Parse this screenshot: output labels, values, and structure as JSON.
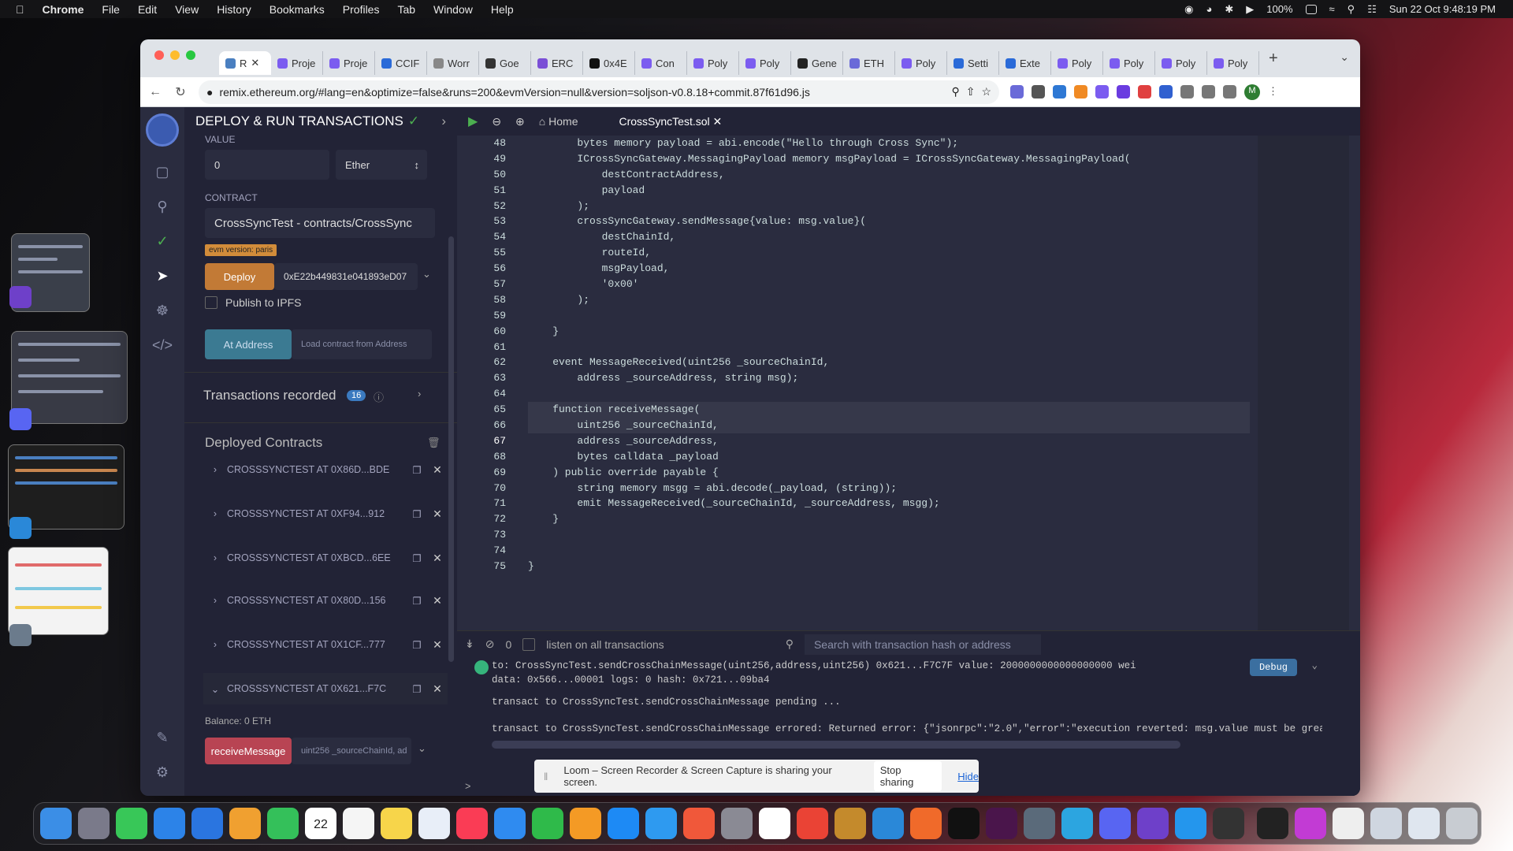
{
  "menubar": {
    "app": "Chrome",
    "items": [
      "File",
      "Edit",
      "View",
      "History",
      "Bookmarks",
      "Profiles",
      "Tab",
      "Window",
      "Help"
    ],
    "battery": "100%",
    "datetime": "Sun 22 Oct  9:48:19 PM"
  },
  "browser": {
    "tabs": [
      "R",
      "Proje",
      "Proje",
      "CCIF",
      "Worr",
      "Goe",
      "ERC",
      "0x4E",
      "Con",
      "Poly",
      "Poly",
      "Gene",
      "ETH",
      "Poly",
      "Setti",
      "Exte",
      "Poly",
      "Poly",
      "Poly",
      "Poly"
    ],
    "url": "remix.ethereum.org/#lang=en&optimize=false&runs=200&evmVersion=null&version=soljson-v0.8.18+commit.87f61d96.js",
    "profile": "M"
  },
  "panel": {
    "title": "DEPLOY & RUN TRANSACTIONS",
    "value_label": "VALUE",
    "value": "0",
    "unit": "Ether",
    "contract_label": "CONTRACT",
    "contract": "CrossSyncTest - contracts/CrossSync",
    "evm": "evm version: paris",
    "deploy": "Deploy",
    "deploy_arg": "0xE22b449831e041893eD07",
    "ipfs": "Publish to IPFS",
    "at_address": "At Address",
    "load_placeholder": "Load contract from Address",
    "tx_recorded": "Transactions recorded",
    "tx_count": "16",
    "deployed": "Deployed Contracts",
    "contracts": [
      "CROSSSYNCTEST AT 0X86D...BDE",
      "CROSSSYNCTEST AT 0XF94...912",
      "CROSSSYNCTEST AT 0XBCD...6EE",
      "CROSSSYNCTEST AT 0X80D...156",
      "CROSSSYNCTEST AT 0X1CF...777",
      "CROSSSYNCTEST AT 0X621...F7C"
    ],
    "balance": "Balance: 0 ETH",
    "receive": "receiveMessage",
    "receive_params": "uint256 _sourceChainId, ad"
  },
  "editor": {
    "home": "Home",
    "file": "CrossSyncTest.sol",
    "first_line": 48,
    "code": [
      "        bytes memory payload = abi.encode(\"Hello through Cross Sync\");",
      "        ICrossSyncGateway.MessagingPayload memory msgPayload = ICrossSyncGateway.MessagingPayload(",
      "            destContractAddress,",
      "            payload",
      "        );",
      "        crossSyncGateway.sendMessage{value: msg.value}(",
      "            destChainId,",
      "            routeId,",
      "            msgPayload,",
      "            '0x00'",
      "        );",
      "",
      "    }",
      "",
      "    event MessageReceived(uint256 _sourceChainId,",
      "        address _sourceAddress, string msg);",
      "",
      "    function receiveMessage(",
      "        uint256 _sourceChainId,",
      "        address _sourceAddress,",
      "        bytes calldata _payload",
      "    ) public override payable {",
      "        string memory msgg = abi.decode(_payload, (string));",
      "        emit MessageReceived(_sourceChainId, _sourceAddress, msgg);",
      "    }",
      "",
      "",
      "}"
    ]
  },
  "terminal": {
    "count": "0",
    "listen": "listen on all transactions",
    "search": "Search with transaction hash or address",
    "debug": "Debug",
    "lines": [
      "to: CrossSyncTest.sendCrossChainMessage(uint256,address,uint256) 0x621...F7C7F value: 2000000000000000000 wei",
      "data: 0x566...00001 logs: 0 hash: 0x721...09ba4",
      "transact to CrossSyncTest.sendCrossChainMessage pending ...",
      "",
      "transact to CrossSyncTest.sendCrossChainMessage errored: Returned error: {\"jsonrpc\":\"2.0\",\"error\":\"execution reverted: msg.value must be greater th"
    ],
    "prompt": ">"
  },
  "loom": {
    "text": "Loom – Screen Recorder & Screen Capture is sharing your screen.",
    "stop": "Stop sharing",
    "hide": "Hide"
  },
  "dock": {
    "calendar_day": "22",
    "calendar_month": "OCT"
  }
}
